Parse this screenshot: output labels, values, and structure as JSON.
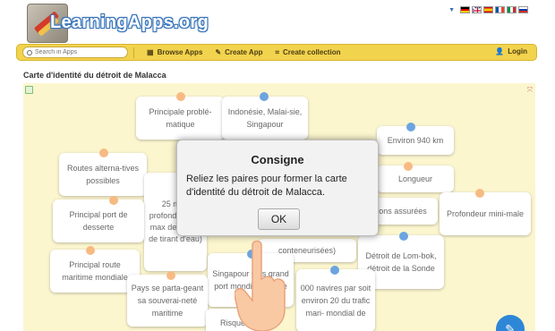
{
  "header": {
    "logo_text": "LearningApps.org",
    "languages": [
      "de",
      "en",
      "es",
      "fr",
      "it",
      "ru"
    ]
  },
  "nav": {
    "search_placeholder": "Search in Apps",
    "browse": "Browse Apps",
    "create": "Create App",
    "collection": "Create collection",
    "login": "Login"
  },
  "page": {
    "title": "Carte d'identité du détroit de Malacca"
  },
  "cards": {
    "c1": "Principale problé-matique",
    "c2": "Indonésie, Malai-sie, Singapour",
    "c3": "Environ 940 km",
    "c4": "Routes alterna-tives possibles",
    "c5": "Longueur",
    "c6": "25 m (e profond format max des 20 m de tirant d'eau)",
    "c7": "Principal port de desserte",
    "c8": "ons assurées",
    "c9": "Profondeur mini-male",
    "c10": "conteneurisées)",
    "c11": "Détroit de Lom-bok, détroit de la Sonde",
    "c12": "Principal route maritime mondiale",
    "c13": "Singapour plus grand port mondial à conte",
    "c14": "000 navires par soit environ 20 du trafic mari- mondial de",
    "c15": "Pays se parta-geant sa souverai-neté maritime",
    "c16": "Risque"
  },
  "modal": {
    "title": "Consigne",
    "body": "Reliez les paires pour former la carte d'identité du détroit de Malacca.",
    "ok": "OK"
  },
  "colors": {
    "navbar": "#f2d34e",
    "board": "#fbf3bf",
    "dot_orange": "#f5a35a",
    "dot_blue": "#3b86d6",
    "edit_button": "#2e86d6"
  }
}
